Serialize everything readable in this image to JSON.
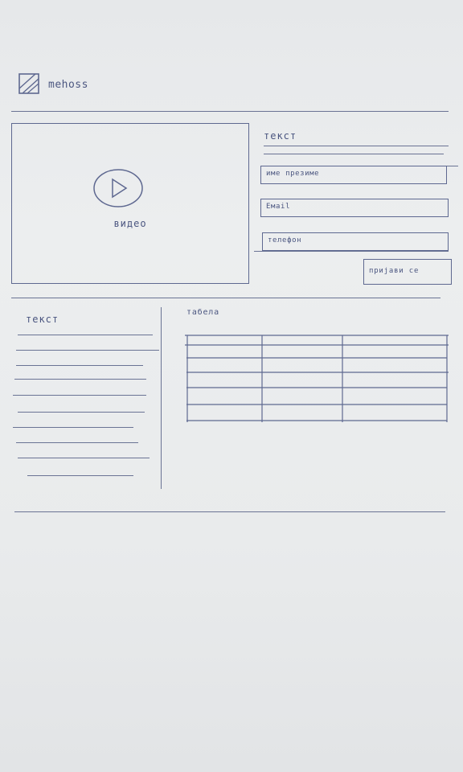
{
  "header": {
    "logo_text": "mehoss"
  },
  "video": {
    "label": "видео"
  },
  "signup": {
    "title": "текст",
    "name_placeholder": "име презиме",
    "email_placeholder": "Емаil",
    "phone_placeholder": "телефон",
    "submit_label": "пријави се"
  },
  "content": {
    "left_title": "текст",
    "table_title": "табела",
    "table": {
      "rows": 6,
      "columns": 3
    }
  },
  "icons": [
    "logo-icon",
    "play-icon"
  ]
}
